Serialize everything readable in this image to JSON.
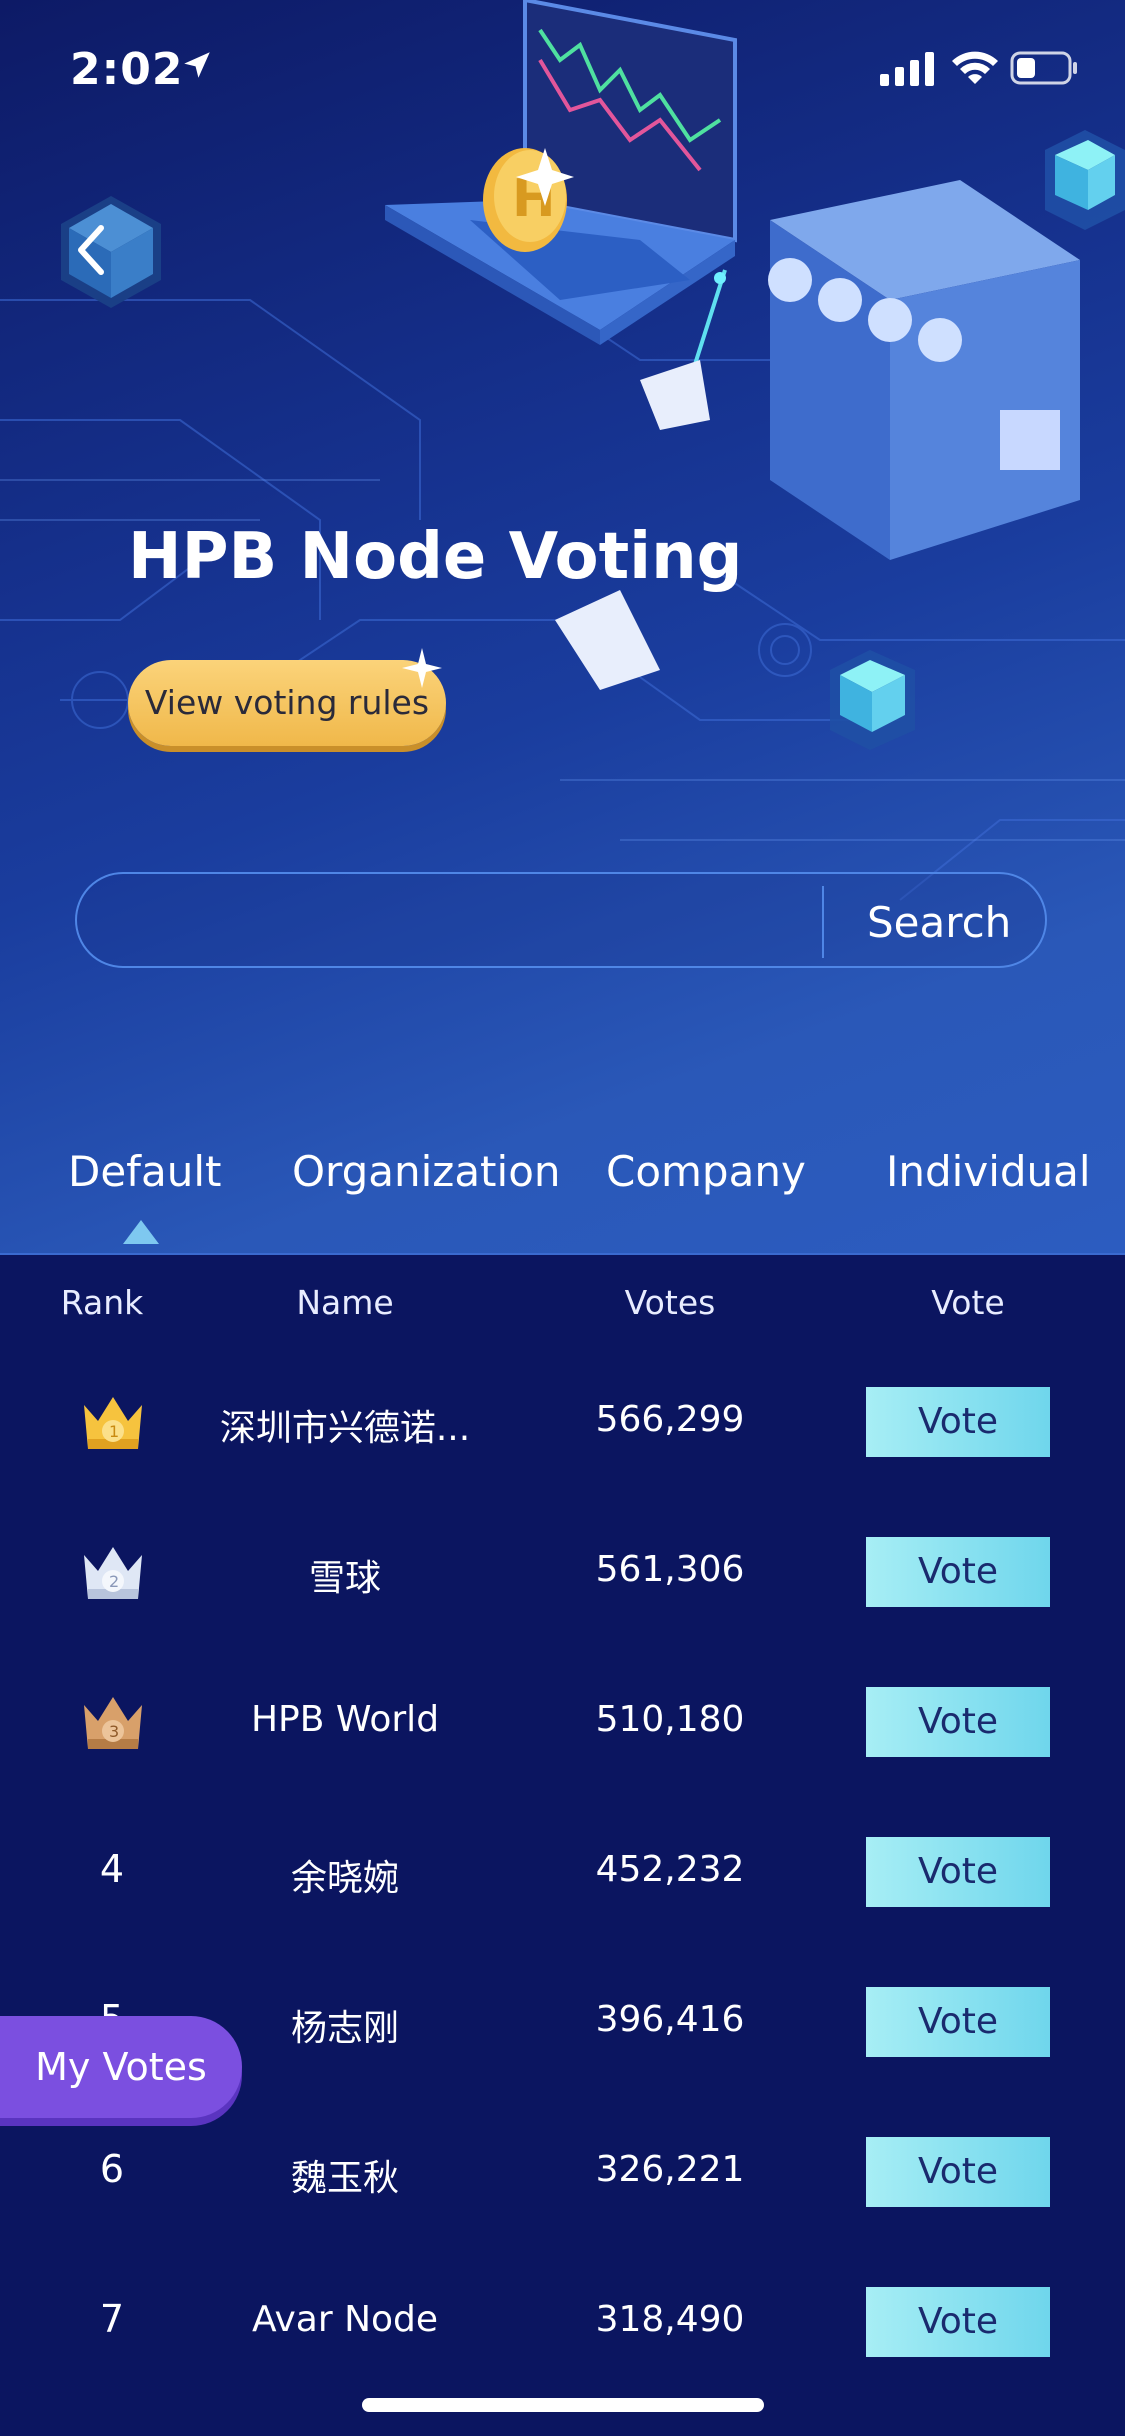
{
  "status_bar": {
    "time": "2:02"
  },
  "hero": {
    "title": "HPB Node Voting",
    "rules_button": "View voting rules"
  },
  "search": {
    "button": "Search",
    "value": "",
    "placeholder": ""
  },
  "tabs": [
    "Default",
    "Organization",
    "Company",
    "Individual"
  ],
  "active_tab": "Default",
  "table": {
    "headers": {
      "rank": "Rank",
      "name": "Name",
      "votes": "Votes",
      "vote": "Vote"
    },
    "rows": [
      {
        "rank": "1",
        "name": "深圳市兴德诺...",
        "votes": "566,299",
        "vote": "Vote",
        "crown": "gold-crown-icon"
      },
      {
        "rank": "2",
        "name": "雪球",
        "votes": "561,306",
        "vote": "Vote",
        "crown": "silver-crown-icon"
      },
      {
        "rank": "3",
        "name": "HPB World",
        "votes": "510,180",
        "vote": "Vote",
        "crown": "bronze-crown-icon"
      },
      {
        "rank": "4",
        "name": "余晓婉",
        "votes": "452,232",
        "vote": "Vote"
      },
      {
        "rank": "5",
        "name": "杨志刚",
        "votes": "396,416",
        "vote": "Vote"
      },
      {
        "rank": "6",
        "name": "魏玉秋",
        "votes": "326,221",
        "vote": "Vote"
      },
      {
        "rank": "7",
        "name": "Avar Node",
        "votes": "318,490",
        "vote": "Vote"
      }
    ]
  },
  "floating": {
    "my_votes": "My Votes"
  },
  "colors": {
    "accent": "#f0b84a",
    "vote_button": "#8fe3f1",
    "my_votes": "#7b4fe0",
    "background": "#0b1560"
  }
}
